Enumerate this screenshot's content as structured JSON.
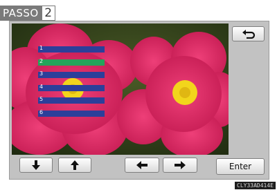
{
  "step": {
    "label": "PASSO",
    "number": "2"
  },
  "list": {
    "items": [
      {
        "label": "1",
        "selected": false
      },
      {
        "label": "2",
        "selected": true
      },
      {
        "label": "3",
        "selected": false
      },
      {
        "label": "4",
        "selected": false
      },
      {
        "label": "5",
        "selected": false
      },
      {
        "label": "6",
        "selected": false
      }
    ]
  },
  "buttons": {
    "back_icon": "return-arrow-icon",
    "down_icon": "arrow-down-icon",
    "up_icon": "arrow-up-icon",
    "left_icon": "arrow-left-icon",
    "right_icon": "arrow-right-icon",
    "enter_label": "Enter"
  },
  "figure_code": "CLY33AD414E",
  "colors": {
    "list_item": "#2c3f9a",
    "list_item_selected": "#25a45a",
    "flower": "#d9275f",
    "flower_center": "#f2d51c"
  }
}
